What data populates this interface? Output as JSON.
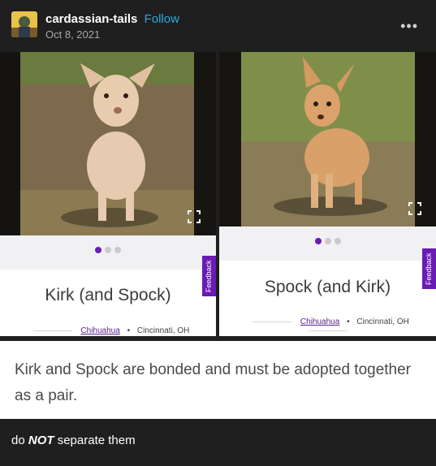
{
  "post": {
    "blog_name": "cardassian-tails",
    "follow_label": "Follow",
    "date": "Oct 8, 2021",
    "more_icon": "ellipsis-icon"
  },
  "listings": [
    {
      "title": "Kirk (and Spock)",
      "breed": "Chihuahua",
      "separator": "•",
      "location": "Cincinnati, OH",
      "feedback_label": "Feedback",
      "active_dot": 1,
      "dot_count": 3
    },
    {
      "title": "Spock (and Kirk)",
      "breed": "Chihuahua",
      "separator": "•",
      "location": "Cincinnati, OH",
      "feedback_label": "Feedback",
      "active_dot": 1,
      "dot_count": 3
    }
  ],
  "caption_image_text": "Kirk and Spock are bonded and must be adopted together as a pair.",
  "post_text": {
    "prefix": "do",
    "emphasis": "NOT",
    "suffix": "separate them"
  }
}
